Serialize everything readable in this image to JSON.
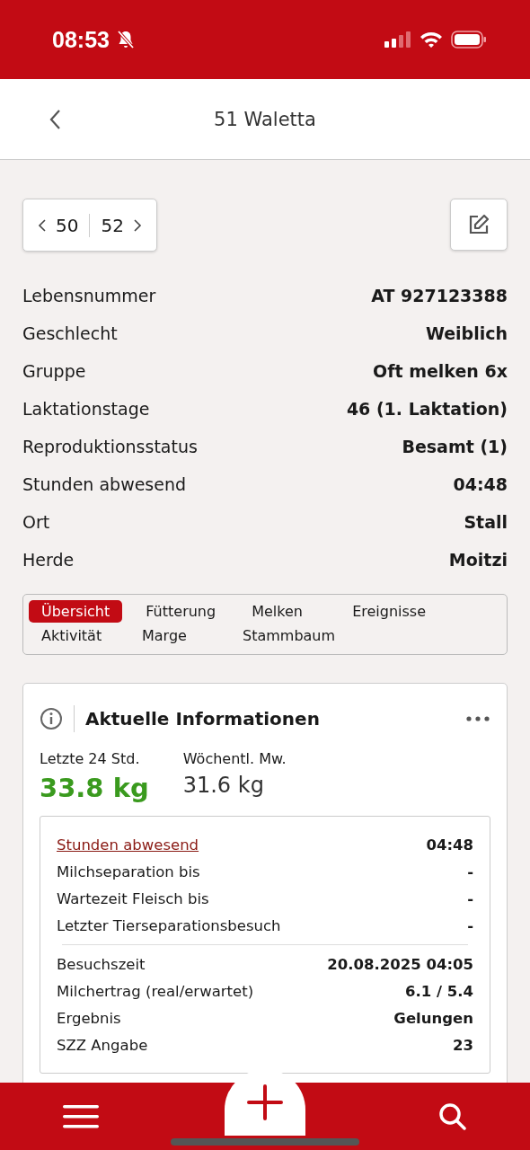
{
  "status_bar": {
    "time": "08:53"
  },
  "header": {
    "title": "51 Waletta"
  },
  "navigator": {
    "previous": "50",
    "next": "52"
  },
  "details": [
    {
      "label": "Lebensnummer",
      "value": "AT 927123388"
    },
    {
      "label": "Geschlecht",
      "value": "Weiblich"
    },
    {
      "label": "Gruppe",
      "value": "Oft melken 6x"
    },
    {
      "label": "Laktationstage",
      "value": "46 (1. Laktation)"
    },
    {
      "label": "Reproduktionsstatus",
      "value": "Besamt (1)"
    },
    {
      "label": "Stunden abwesend",
      "value": "04:48"
    },
    {
      "label": "Ort",
      "value": "Stall"
    },
    {
      "label": "Herde",
      "value": "Moitzi"
    }
  ],
  "tabs": [
    {
      "label": "Übersicht",
      "selected": true
    },
    {
      "label": "Fütterung",
      "selected": false
    },
    {
      "label": "Melken",
      "selected": false
    },
    {
      "label": "Ereignisse",
      "selected": false
    },
    {
      "label": "Aktivität",
      "selected": false
    },
    {
      "label": "Marge",
      "selected": false
    },
    {
      "label": "Stammbaum",
      "selected": false
    }
  ],
  "card": {
    "title": "Aktuelle Informationen",
    "stats": [
      {
        "label": "Letzte 24 Std.",
        "value": "33.8 kg",
        "highlight": true
      },
      {
        "label": "Wöchentl. Mw.",
        "value": "31.6 kg",
        "highlight": false
      }
    ],
    "groups": [
      [
        {
          "label": "Stunden abwesend",
          "value": "04:48",
          "link": true
        },
        {
          "label": "Milchseparation bis",
          "value": "-",
          "link": false
        },
        {
          "label": "Wartezeit Fleisch bis",
          "value": "-",
          "link": false
        },
        {
          "label": "Letzter Tierseparationsbesuch",
          "value": "-",
          "link": false
        }
      ],
      [
        {
          "label": "Besuchszeit",
          "value": "20.08.2025 04:05",
          "link": false
        },
        {
          "label": "Milchertrag (real/erwartet)",
          "value": "6.1 / 5.4",
          "link": false
        },
        {
          "label": "Ergebnis",
          "value": "Gelungen",
          "link": false
        },
        {
          "label": "SZZ Angabe",
          "value": "23",
          "link": false
        }
      ]
    ]
  }
}
